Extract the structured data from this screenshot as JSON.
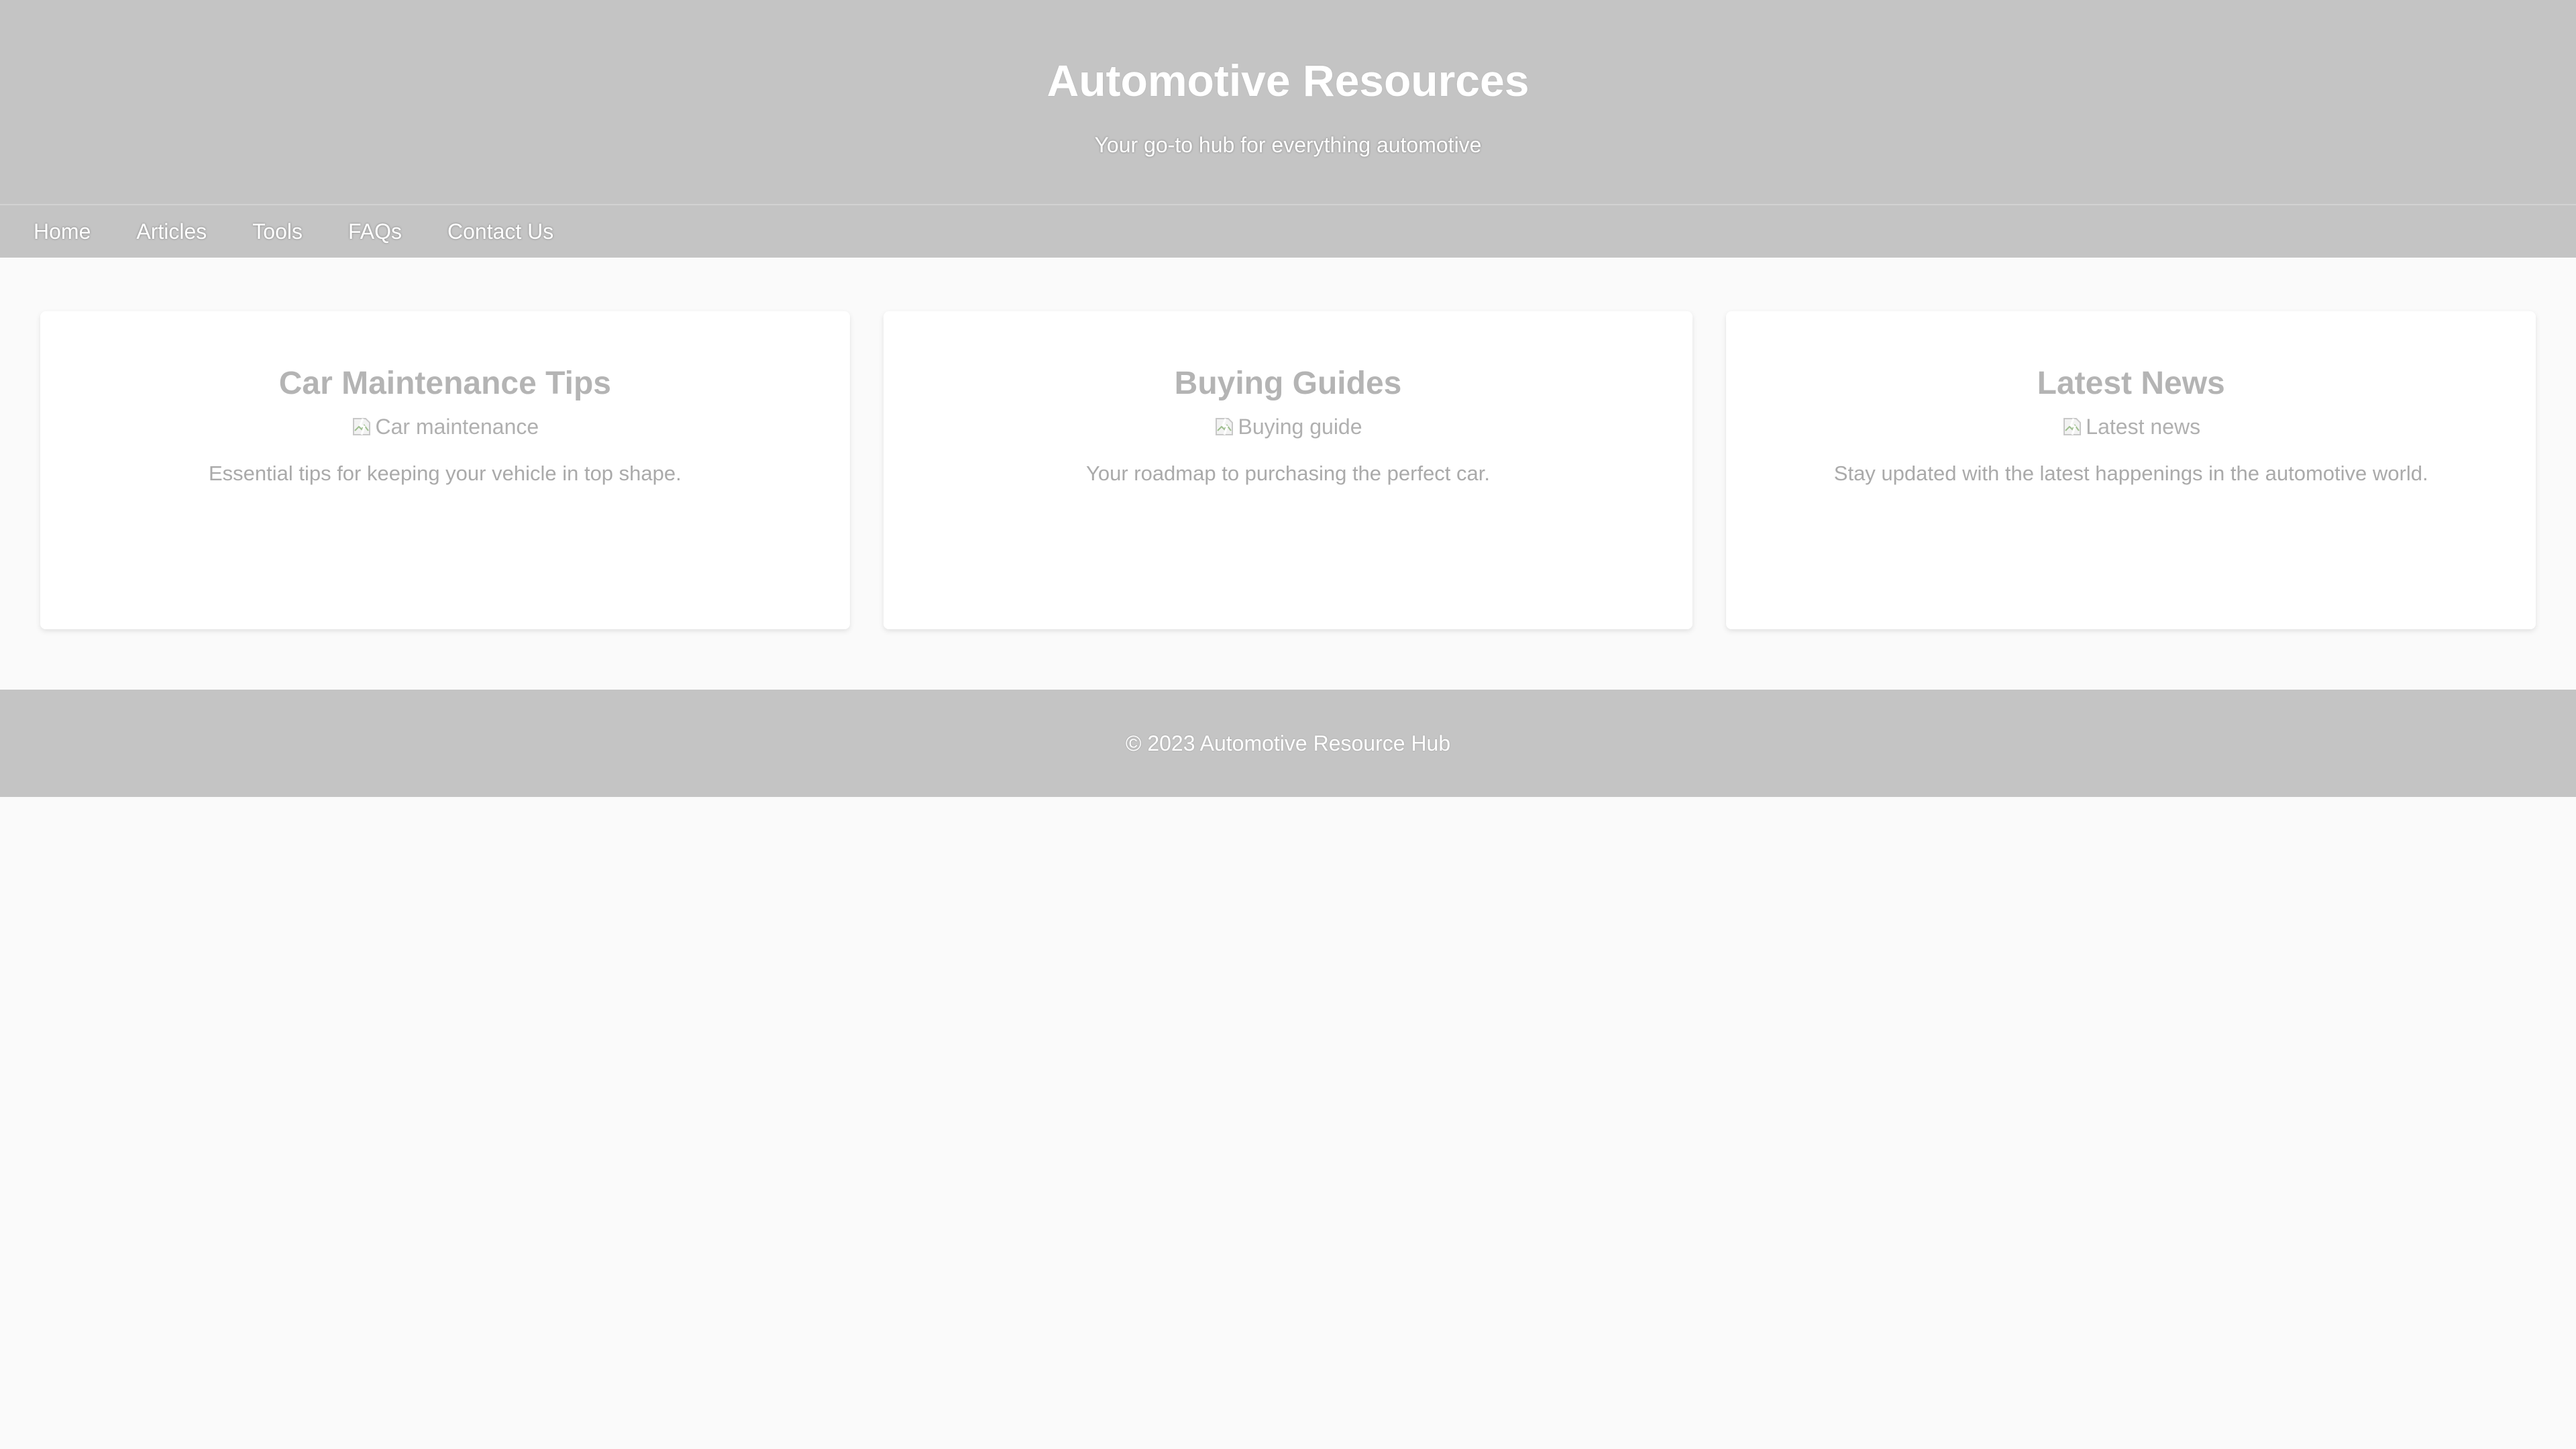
{
  "header": {
    "title": "Automotive Resources",
    "tagline": "Your go-to hub for everything automotive"
  },
  "nav": {
    "items": [
      {
        "label": "Home"
      },
      {
        "label": "Articles"
      },
      {
        "label": "Tools"
      },
      {
        "label": "FAQs"
      },
      {
        "label": "Contact Us"
      }
    ]
  },
  "cards": [
    {
      "title": "Car Maintenance Tips",
      "image_alt": "Car maintenance",
      "description": "Essential tips for keeping your vehicle in top shape."
    },
    {
      "title": "Buying Guides",
      "image_alt": "Buying guide",
      "description": "Your roadmap to purchasing the perfect car."
    },
    {
      "title": "Latest News",
      "image_alt": "Latest news",
      "description": "Stay updated with the latest happenings in the automotive world."
    }
  ],
  "footer": {
    "copyright": "© 2023 Automotive Resource Hub"
  },
  "colors": {
    "header_bg": "#c4c4c4",
    "page_bg": "#fafafa",
    "card_bg": "#ffffff",
    "card_title": "#b4b4b4",
    "card_text": "#aaaaaa"
  }
}
